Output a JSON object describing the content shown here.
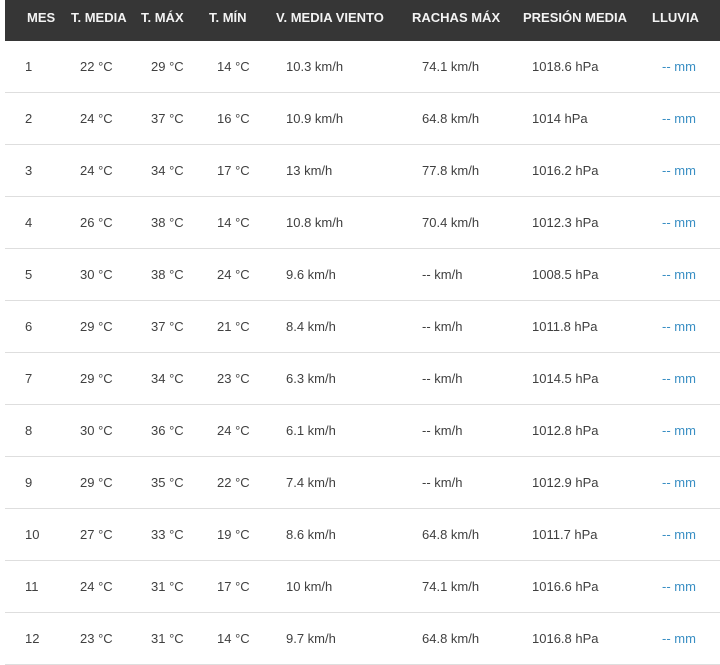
{
  "headers": {
    "mes": "MES",
    "t_media": "T. MEDIA",
    "t_max": "T. MÁX",
    "t_min": "T. MÍN",
    "v_media_viento": "V. MEDIA VIENTO",
    "rachas_max": "RACHAS MÁX",
    "presion_media": "PRESIÓN MEDIA",
    "lluvia": "LLUVIA"
  },
  "rows": [
    {
      "mes": "1",
      "t_media": "22 °C",
      "t_max": "29 °C",
      "t_min": "14 °C",
      "v_media_viento": "10.3 km/h",
      "rachas_max": "74.1 km/h",
      "presion_media": "1018.6 hPa",
      "lluvia": "-- mm"
    },
    {
      "mes": "2",
      "t_media": "24 °C",
      "t_max": "37 °C",
      "t_min": "16 °C",
      "v_media_viento": "10.9 km/h",
      "rachas_max": "64.8 km/h",
      "presion_media": "1014 hPa",
      "lluvia": "-- mm"
    },
    {
      "mes": "3",
      "t_media": "24 °C",
      "t_max": "34 °C",
      "t_min": "17 °C",
      "v_media_viento": "13 km/h",
      "rachas_max": "77.8 km/h",
      "presion_media": "1016.2 hPa",
      "lluvia": "-- mm"
    },
    {
      "mes": "4",
      "t_media": "26 °C",
      "t_max": "38 °C",
      "t_min": "14 °C",
      "v_media_viento": "10.8 km/h",
      "rachas_max": "70.4 km/h",
      "presion_media": "1012.3 hPa",
      "lluvia": "-- mm"
    },
    {
      "mes": "5",
      "t_media": "30 °C",
      "t_max": "38 °C",
      "t_min": "24 °C",
      "v_media_viento": "9.6 km/h",
      "rachas_max": "-- km/h",
      "presion_media": "1008.5 hPa",
      "lluvia": "-- mm"
    },
    {
      "mes": "6",
      "t_media": "29 °C",
      "t_max": "37 °C",
      "t_min": "21 °C",
      "v_media_viento": "8.4 km/h",
      "rachas_max": "-- km/h",
      "presion_media": "1011.8 hPa",
      "lluvia": "-- mm"
    },
    {
      "mes": "7",
      "t_media": "29 °C",
      "t_max": "34 °C",
      "t_min": "23 °C",
      "v_media_viento": "6.3 km/h",
      "rachas_max": "-- km/h",
      "presion_media": "1014.5 hPa",
      "lluvia": "-- mm"
    },
    {
      "mes": "8",
      "t_media": "30 °C",
      "t_max": "36 °C",
      "t_min": "24 °C",
      "v_media_viento": "6.1 km/h",
      "rachas_max": "-- km/h",
      "presion_media": "1012.8 hPa",
      "lluvia": "-- mm"
    },
    {
      "mes": "9",
      "t_media": "29 °C",
      "t_max": "35 °C",
      "t_min": "22 °C",
      "v_media_viento": "7.4 km/h",
      "rachas_max": "-- km/h",
      "presion_media": "1012.9 hPa",
      "lluvia": "-- mm"
    },
    {
      "mes": "10",
      "t_media": "27 °C",
      "t_max": "33 °C",
      "t_min": "19 °C",
      "v_media_viento": "8.6 km/h",
      "rachas_max": "64.8 km/h",
      "presion_media": "1011.7 hPa",
      "lluvia": "-- mm"
    },
    {
      "mes": "11",
      "t_media": "24 °C",
      "t_max": "31 °C",
      "t_min": "17 °C",
      "v_media_viento": "10 km/h",
      "rachas_max": "74.1 km/h",
      "presion_media": "1016.6 hPa",
      "lluvia": "-- mm"
    },
    {
      "mes": "12",
      "t_media": "23 °C",
      "t_max": "31 °C",
      "t_min": "14 °C",
      "v_media_viento": "9.7 km/h",
      "rachas_max": "64.8 km/h",
      "presion_media": "1016.8 hPa",
      "lluvia": "-- mm"
    }
  ],
  "colors": {
    "header_bg": "#363636",
    "header_text": "#f3f3f3",
    "body_text": "#404040",
    "rain_link": "#3a8fc4",
    "row_divider": "#dedede"
  }
}
